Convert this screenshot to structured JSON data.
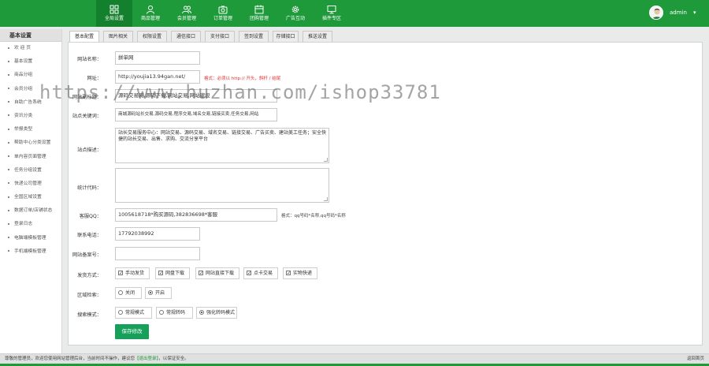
{
  "topnav": {
    "items": [
      {
        "label": "全局设置",
        "icon": "grid-icon"
      },
      {
        "label": "商品管理",
        "icon": "user-icon"
      },
      {
        "label": "会员管理",
        "icon": "users-icon"
      },
      {
        "label": "订单管理",
        "icon": "camera-icon"
      },
      {
        "label": "团购管理",
        "icon": "calendar-icon"
      },
      {
        "label": "广告互动",
        "icon": "gear-icon"
      },
      {
        "label": "插件专区",
        "icon": "monitor-icon"
      }
    ],
    "user": {
      "name": "admin",
      "caret": "▾"
    }
  },
  "sidebar": {
    "title": "基本设置",
    "items": [
      "欢 迎 页",
      "基本设置",
      "商品分组",
      "会员分组",
      "自助广告系统",
      "资讯分类",
      "举报类型",
      "帮助中心分类设置",
      "单内容页面管理",
      "任务分组设置",
      "快递公司管理",
      "全国区域设置",
      "数据订单/店铺状态",
      "登录日志",
      "电脑端模板管理",
      "手机端模板管理"
    ]
  },
  "tabs": [
    "基本配置",
    "图片相关",
    "权限设置",
    "通信接口",
    "支付接口",
    "签到设置",
    "存储接口",
    "推送设置"
  ],
  "form": {
    "site_name_label": "网站名称：",
    "site_name": "拼单网",
    "url_label": "网址：",
    "url": "http://youjia13.94gan.net/",
    "url_hint": "格式：必须以 http:// 开头，斜杆 / 结尾",
    "subtitle_label": "网站副标题：",
    "subtitle": "源码交易网,源码下载,网站交易,网站建设",
    "keywords_label": "站点关键词：",
    "keywords": "商城源码站长交易,源码交易,程序交易,域名交易,链接买卖,任务交易,网站",
    "desc_label": "站点描述：",
    "desc": "站长交易服务中心：网站交易、源码交易、域名交易、链接交易、广告买卖、建站美工任务；安全快捷的站长交易、出售、求购、交流分享平台",
    "stats_label": "统计代码：",
    "stats": "",
    "qq_label": "客服QQ：",
    "qq": "1005618718*购买源码,382836698*客服",
    "qq_hint": "格式：qq号码*名称,qq号码*名称",
    "phone_label": "联系电话：",
    "phone": "17792038992",
    "icp_label": "网站备案号：",
    "icp": "",
    "ship_label": "发货方式：",
    "ship_options": [
      {
        "label": "手动发货",
        "checked": true
      },
      {
        "label": "网盘下载",
        "checked": true
      },
      {
        "label": "网站直接下载",
        "checked": true
      },
      {
        "label": "点卡交易",
        "checked": true
      },
      {
        "label": "实物快递",
        "checked": true
      }
    ],
    "region_label": "区域检索：",
    "region_options": [
      {
        "label": "关闭",
        "selected": false
      },
      {
        "label": "开启",
        "selected": true
      }
    ],
    "search_label": "搜索模式：",
    "search_options": [
      {
        "label": "常规模式",
        "selected": false
      },
      {
        "label": "常规转码",
        "selected": false
      },
      {
        "label": "强化转码模式",
        "selected": true
      }
    ],
    "save": "保存修改"
  },
  "footer": {
    "left": "尊敬的管理员，欢迎您使用网站管理后台，当前时间不操作，建议您",
    "link": "【退出登录】",
    "left_tail": "，以保证安全。",
    "right": "返回首页"
  },
  "watermark": "https://www.huzhan.com/ishop33781",
  "colors": {
    "brand": "#1f9a3b",
    "save": "#16a05a",
    "hint_red": "#e03030"
  }
}
